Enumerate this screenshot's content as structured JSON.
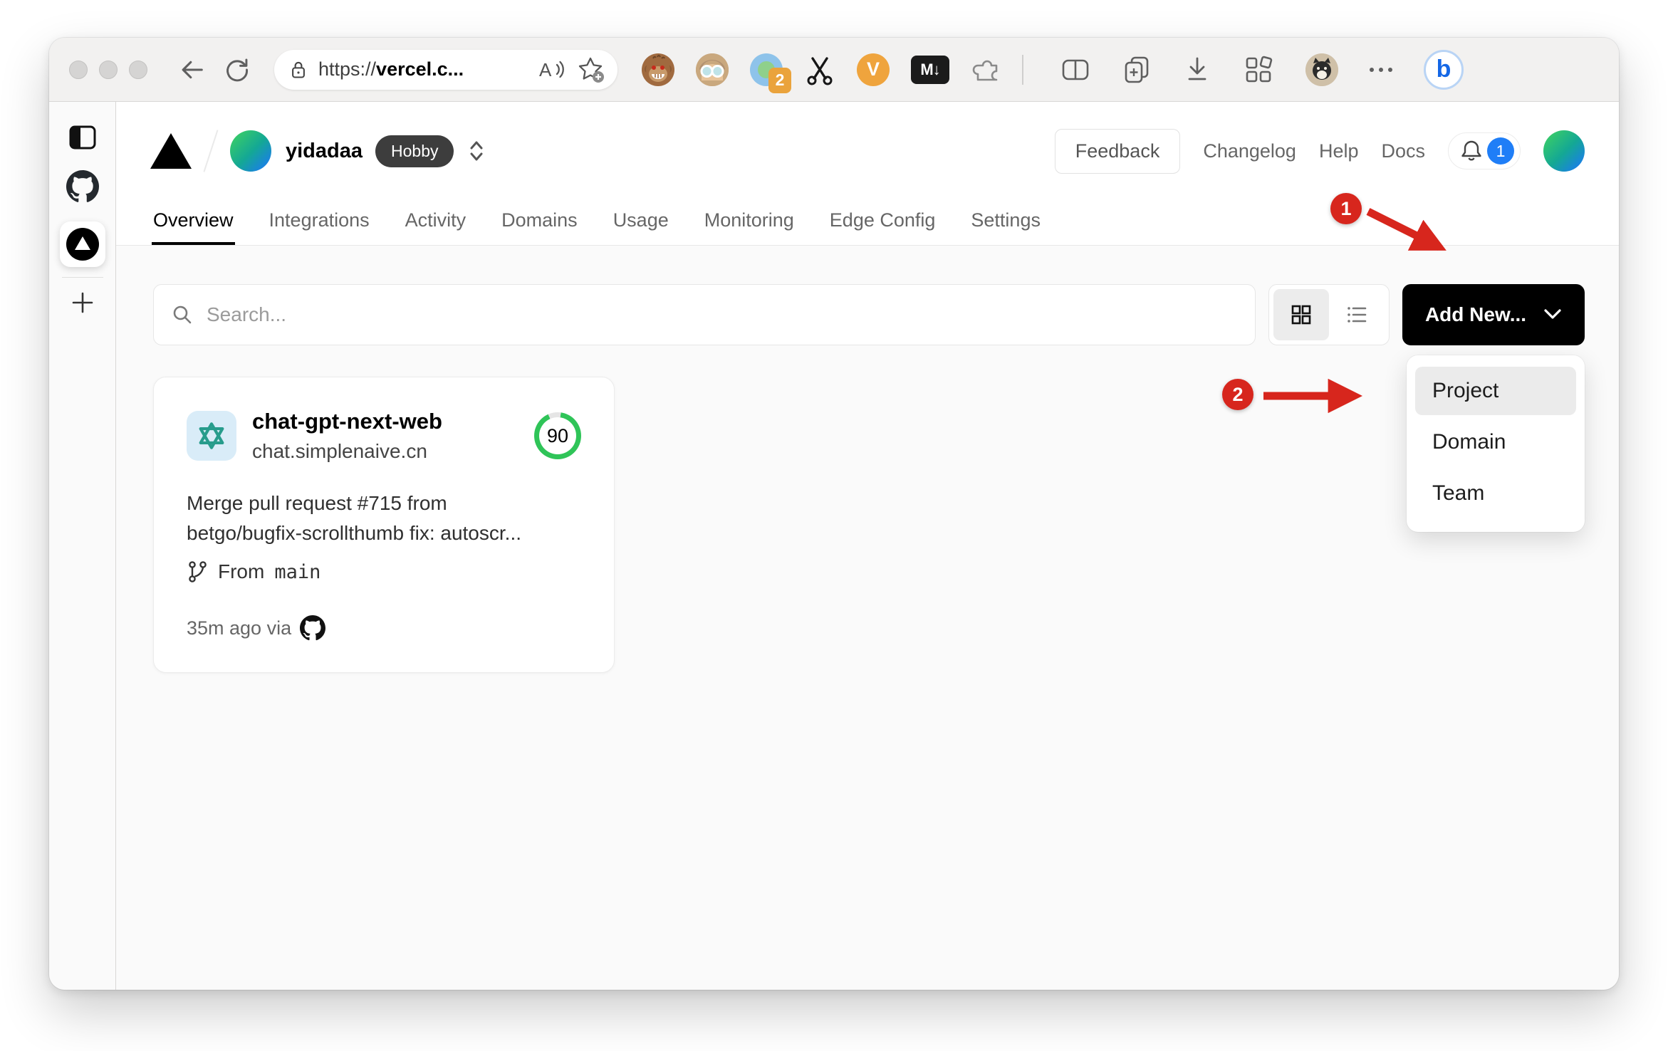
{
  "browser": {
    "url": {
      "scheme": "https://",
      "domain": "vercel.c..."
    },
    "read_aloud_label": "A",
    "translate_badge": "2",
    "video_ext_label": "V",
    "markdown_ext_label": "M↓",
    "bing_label": "b"
  },
  "header": {
    "team_name": "yidadaa",
    "plan_badge": "Hobby",
    "feedback_label": "Feedback",
    "changelog_label": "Changelog",
    "help_label": "Help",
    "docs_label": "Docs",
    "notification_count": "1"
  },
  "tabs": [
    {
      "label": "Overview",
      "active": true
    },
    {
      "label": "Integrations",
      "active": false
    },
    {
      "label": "Activity",
      "active": false
    },
    {
      "label": "Domains",
      "active": false
    },
    {
      "label": "Usage",
      "active": false
    },
    {
      "label": "Monitoring",
      "active": false
    },
    {
      "label": "Edge Config",
      "active": false
    },
    {
      "label": "Settings",
      "active": false
    }
  ],
  "controls": {
    "search_placeholder": "Search...",
    "add_new_label": "Add New..."
  },
  "add_new_menu": {
    "items": [
      {
        "label": "Project",
        "highlighted": true
      },
      {
        "label": "Domain",
        "highlighted": false
      },
      {
        "label": "Team",
        "highlighted": false
      }
    ]
  },
  "project_card": {
    "name": "chat-gpt-next-web",
    "domain": "chat.simplenaive.cn",
    "score": "90",
    "commit_line1": "Merge pull request #715 from",
    "commit_line2": "betgo/bugfix-scrollthumb fix: autoscr...",
    "from_label": "From",
    "branch_name": "main",
    "deployed_meta": "35m ago via"
  },
  "annotations": {
    "step1": "1",
    "step2": "2"
  },
  "colors": {
    "annotation_red": "#d7261d",
    "score_green": "#2fc458",
    "notification_blue": "#1f7ef7",
    "add_new_bg": "#000000",
    "hobby_badge_bg": "#3d3d3d",
    "ai_tile_bg": "#d9ecf8",
    "ai_logo_teal": "#279c8c"
  },
  "icons": {
    "back-icon": "left arrow",
    "refresh-icon": "circular arrow",
    "lock-icon": "padlock",
    "read-aloud-icon": "A with sound waves",
    "add-favorite-icon": "star with plus",
    "tampermonkey-icon": "monkey face",
    "avatar-ext-icon": "granny with glasses",
    "translate-ext-icon": "blue circle green dot badge 2",
    "scissors-ext-icon": "scissors",
    "video-ext-icon": "orange V",
    "markdown-ext-icon": "M down-arrow tile",
    "extensions-puzzle-icon": "puzzle piece",
    "split-screen-icon": "split rectangle",
    "collections-icon": "stacked cards plus",
    "downloads-icon": "down arrow over line",
    "apps-icon": "grid with diamond",
    "more-menu-icon": "three dots",
    "bing-chat-icon": "b bubble",
    "sidebar-panel-icon": "panel layout",
    "github-icon": "octocat mark",
    "vercel-icon": "triangle in circle",
    "new-tab-icon": "plus",
    "search-icon": "magnifier",
    "grid-view-icon": "four squares",
    "list-view-icon": "list lines",
    "chevron-down-icon": "v",
    "selector-chevrons-icon": "up down chevrons",
    "bell-icon": "bell outline",
    "branch-icon": "git branch",
    "openai-logo-icon": "teal knot"
  }
}
